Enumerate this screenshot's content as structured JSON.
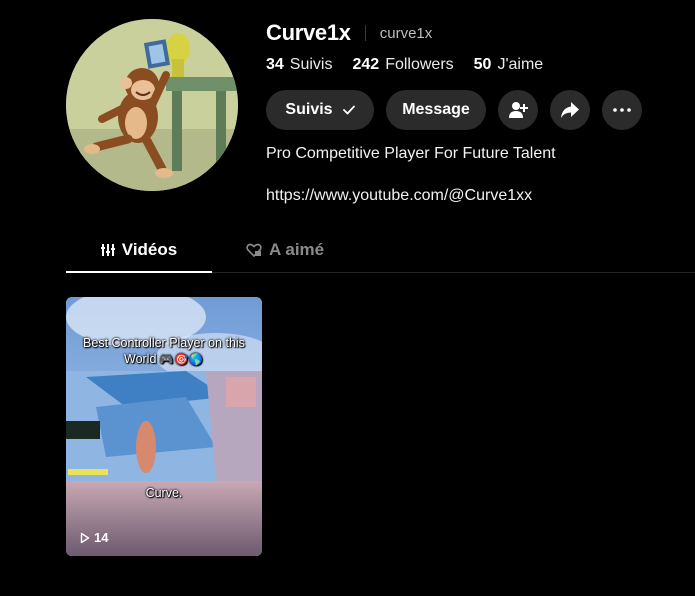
{
  "profile": {
    "display_name": "Curve1x",
    "username": "curve1x",
    "bio": "Pro Competitive Player For Future Talent",
    "link": "https://www.youtube.com/@Curve1xx",
    "avatar_icon": "curious-george-avatar"
  },
  "stats": [
    {
      "value": "34",
      "label": "Suivis"
    },
    {
      "value": "242",
      "label": "Followers"
    },
    {
      "value": "50",
      "label": "J'aime"
    }
  ],
  "actions": {
    "follow_label": "Suivis",
    "follow_icon": "checkmark-icon",
    "message_label": "Message",
    "add_friend_icon": "add-user-icon",
    "share_icon": "share-icon",
    "more_icon": "more-icon"
  },
  "tabs": [
    {
      "label": "Vidéos",
      "icon": "grid-icon",
      "active": true
    },
    {
      "label": "A aimé",
      "icon": "heart-lock-icon",
      "active": false
    }
  ],
  "videos": [
    {
      "overlay_title": "Best Controller Player on this World",
      "overlay_emoji": "🎮🎯🌎",
      "caption": "Curve.",
      "views": "14",
      "views_icon": "play-icon"
    }
  ],
  "colors": {
    "background": "#000000",
    "button_bg": "#2b2b2b",
    "muted_text": "#8a8a8a",
    "divider": "#262626"
  }
}
